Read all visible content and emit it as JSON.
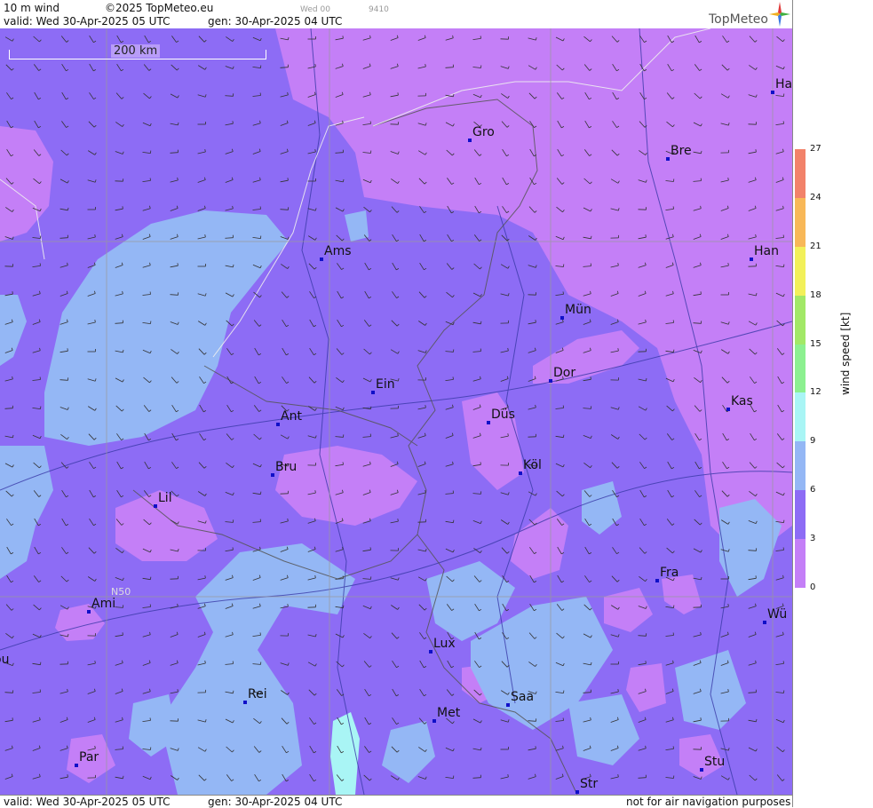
{
  "header": {
    "field": "10 m wind",
    "copyright": "©2025 TopMeteo.eu",
    "run_small": "Wed 00",
    "code_small": "9410",
    "valid": "valid:  Wed  30-Apr-2025  05 UTC",
    "gen": "gen: 30-Apr-2025 04 UTC",
    "logo": "TopMeteo"
  },
  "footer": {
    "valid": "valid:  Wed  30-Apr-2025  05 UTC",
    "gen": "gen: 30-Apr-2025 04 UTC",
    "disclaimer": "not for air navigation purposes"
  },
  "scale_bar": {
    "label": "200 km"
  },
  "grid_label": "N50",
  "colorbar": {
    "label": "wind  speed  [kt]",
    "ticks": [
      "0",
      "3",
      "6",
      "9",
      "12",
      "15",
      "18",
      "21",
      "24",
      "27"
    ],
    "colors": [
      "#c47ff7",
      "#8d6cf5",
      "#94b7f5",
      "#a9f5f5",
      "#8cf090",
      "#a2e867",
      "#f2f05a",
      "#f8b858",
      "#f2826a"
    ]
  },
  "cities": [
    {
      "name": "Gro"
    },
    {
      "name": "Bre"
    },
    {
      "name": "Ha"
    },
    {
      "name": "Ams"
    },
    {
      "name": "Han"
    },
    {
      "name": "Mün"
    },
    {
      "name": "Dor"
    },
    {
      "name": "Ein"
    },
    {
      "name": "Kas"
    },
    {
      "name": "Ant"
    },
    {
      "name": "Düs"
    },
    {
      "name": "Bru"
    },
    {
      "name": "Köl"
    },
    {
      "name": "Lil"
    },
    {
      "name": "Fra"
    },
    {
      "name": "Ami"
    },
    {
      "name": "Wü"
    },
    {
      "name": "Lux"
    },
    {
      "name": "ou"
    },
    {
      "name": "Rei"
    },
    {
      "name": "Saa"
    },
    {
      "name": "Met"
    },
    {
      "name": "Par"
    },
    {
      "name": "Stu"
    },
    {
      "name": "Str"
    }
  ]
}
